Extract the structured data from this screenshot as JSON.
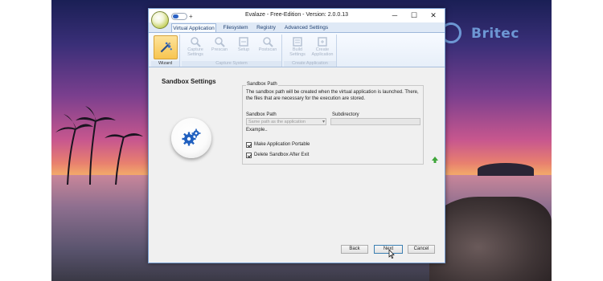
{
  "window": {
    "title": "Evalaze - Free-Edition - Version: 2.0.0.13",
    "qat_plus": "+",
    "min_glyph": "─",
    "max_glyph": "☐",
    "close_glyph": "✕"
  },
  "tabs": [
    {
      "label": "Virtual Application",
      "active": true
    },
    {
      "label": "Filesystem",
      "active": false
    },
    {
      "label": "Registry",
      "active": false
    },
    {
      "label": "Advanced Settings",
      "active": false
    }
  ],
  "ribbon": {
    "groups": [
      {
        "label": "Wizard",
        "buttons": [
          {
            "label": "",
            "icon": "wand-icon"
          }
        ]
      },
      {
        "label": "Capture System",
        "buttons": [
          {
            "label": "Capture Settings",
            "icon": "capture-settings-icon"
          },
          {
            "label": "Prescan",
            "icon": "prescan-icon"
          },
          {
            "label": "Setup",
            "icon": "setup-icon"
          },
          {
            "label": "Postscan",
            "icon": "postscan-icon"
          }
        ]
      },
      {
        "label": "Create Application",
        "buttons": [
          {
            "label": "Build Settings",
            "icon": "build-settings-icon"
          },
          {
            "label": "Create Application",
            "icon": "create-application-icon"
          }
        ]
      }
    ]
  },
  "content": {
    "title": "Sandbox Settings",
    "fieldset_legend": "Sandbox Path",
    "description": "The sandbox path will be created when the virtual application is launched. There, the files that are necessary for the execution are stored.",
    "sandbox_path_label": "Sandbox Path",
    "sandbox_path_value": "Same path as the application",
    "subdirectory_label": "Subdirectory",
    "subdirectory_value": "",
    "example_label": "Example..",
    "make_portable_label": "Make Application Portable",
    "make_portable_checked": true,
    "delete_sandbox_label": "Delete Sandbox After Exit",
    "delete_sandbox_checked": true
  },
  "buttons": {
    "back": "Back",
    "next": "Next",
    "cancel": "Cancel"
  },
  "watermark": {
    "text": "Britec"
  },
  "colors": {
    "accent": "#2b62c4",
    "ribbon_selected": "#f7c550",
    "window_border": "#7aa0d4",
    "up_arrow": "#3fa63a"
  }
}
